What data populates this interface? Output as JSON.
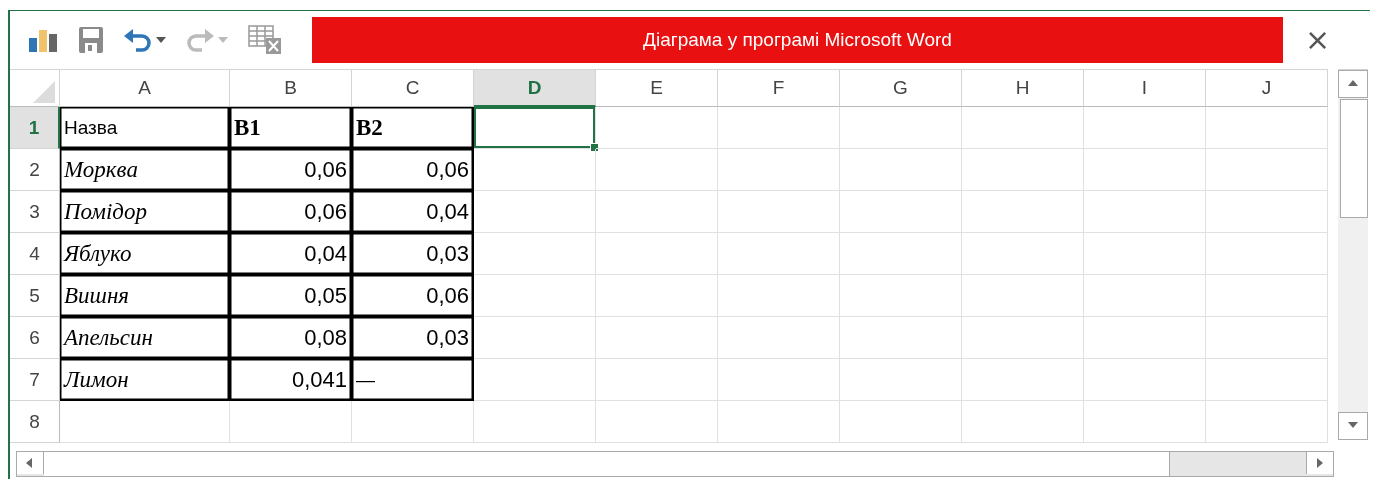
{
  "toolbar": {
    "undo_enabled": true,
    "redo_enabled": false
  },
  "title": "Діаграма у програмі Microsoft Word",
  "close_label": "×",
  "columns": [
    {
      "label": "A",
      "selected": false
    },
    {
      "label": "B",
      "selected": false
    },
    {
      "label": "C",
      "selected": false
    },
    {
      "label": "D",
      "selected": true
    },
    {
      "label": "E",
      "selected": false
    },
    {
      "label": "F",
      "selected": false
    },
    {
      "label": "G",
      "selected": false
    },
    {
      "label": "H",
      "selected": false
    },
    {
      "label": "I",
      "selected": false
    },
    {
      "label": "J",
      "selected": false
    }
  ],
  "rows": [
    {
      "header": "1",
      "selected": true,
      "cells": [
        {
          "kind": "text",
          "text": "Назва",
          "bordered": true,
          "selected": false
        },
        {
          "kind": "text",
          "text": "B1",
          "bordered": true,
          "selected": false
        },
        {
          "kind": "text",
          "text": "B2",
          "bordered": true,
          "selected": false
        },
        {
          "kind": "empty",
          "bordered": false,
          "selected": true
        }
      ]
    },
    {
      "header": "2",
      "selected": false,
      "cells": [
        {
          "kind": "text",
          "text": "Морква",
          "bordered": true,
          "selected": false
        },
        {
          "kind": "number",
          "text": "0,06",
          "bordered": true,
          "selected": false
        },
        {
          "kind": "number",
          "text": "0,06",
          "bordered": true,
          "selected": false
        }
      ]
    },
    {
      "header": "3",
      "selected": false,
      "cells": [
        {
          "kind": "text",
          "text": "Помідор",
          "bordered": true,
          "selected": false
        },
        {
          "kind": "number",
          "text": "0,06",
          "bordered": true,
          "selected": false
        },
        {
          "kind": "number",
          "text": "0,04",
          "bordered": true,
          "selected": false
        }
      ]
    },
    {
      "header": "4",
      "selected": false,
      "cells": [
        {
          "kind": "text",
          "text": "Яблуко",
          "bordered": true,
          "selected": false
        },
        {
          "kind": "number",
          "text": "0,04",
          "bordered": true,
          "selected": false
        },
        {
          "kind": "number",
          "text": "0,03",
          "bordered": true,
          "selected": false
        }
      ]
    },
    {
      "header": "5",
      "selected": false,
      "cells": [
        {
          "kind": "text",
          "text": "Вишня",
          "bordered": true,
          "selected": false
        },
        {
          "kind": "number",
          "text": "0,05",
          "bordered": true,
          "selected": false
        },
        {
          "kind": "number",
          "text": "0,06",
          "bordered": true,
          "selected": false
        }
      ]
    },
    {
      "header": "6",
      "selected": false,
      "cells": [
        {
          "kind": "text",
          "text": "Апельсин",
          "bordered": true,
          "selected": false
        },
        {
          "kind": "number",
          "text": "0,08",
          "bordered": true,
          "selected": false
        },
        {
          "kind": "number",
          "text": "0,03",
          "bordered": true,
          "selected": false
        }
      ]
    },
    {
      "header": "7",
      "selected": false,
      "cells": [
        {
          "kind": "text",
          "text": "Лимон",
          "bordered": true,
          "selected": false
        },
        {
          "kind": "number",
          "text": "0,041",
          "bordered": true,
          "selected": false
        },
        {
          "kind": "text",
          "text": "—",
          "bordered": true,
          "selected": false
        }
      ]
    },
    {
      "header": "8",
      "selected": false,
      "cells": []
    }
  ]
}
